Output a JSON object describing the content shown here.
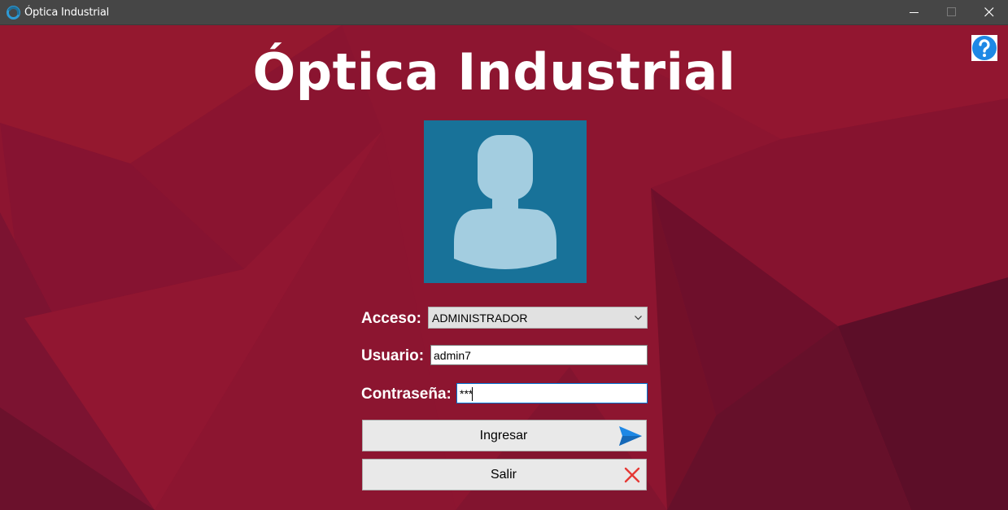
{
  "window": {
    "title": "Óptica Industrial"
  },
  "header": {
    "title": "Óptica Industrial"
  },
  "form": {
    "acceso_label": "Acceso:",
    "acceso_value": "ADMINISTRADOR",
    "usuario_label": "Usuario:",
    "usuario_value": "admin7",
    "contrasena_label": "Contraseña:",
    "contrasena_value": "***"
  },
  "buttons": {
    "ingresar_label": "Ingresar",
    "salir_label": "Salir"
  },
  "icons": {
    "app": "app-logo-icon",
    "help": "help-icon",
    "avatar": "user-avatar-icon",
    "send": "send-icon",
    "close": "close-x-icon"
  },
  "colors": {
    "background": "#8d1530",
    "avatar_bg": "#187299",
    "avatar_fg": "#a3cde0",
    "send_icon": "#1e88e5",
    "close_icon": "#e53935"
  }
}
